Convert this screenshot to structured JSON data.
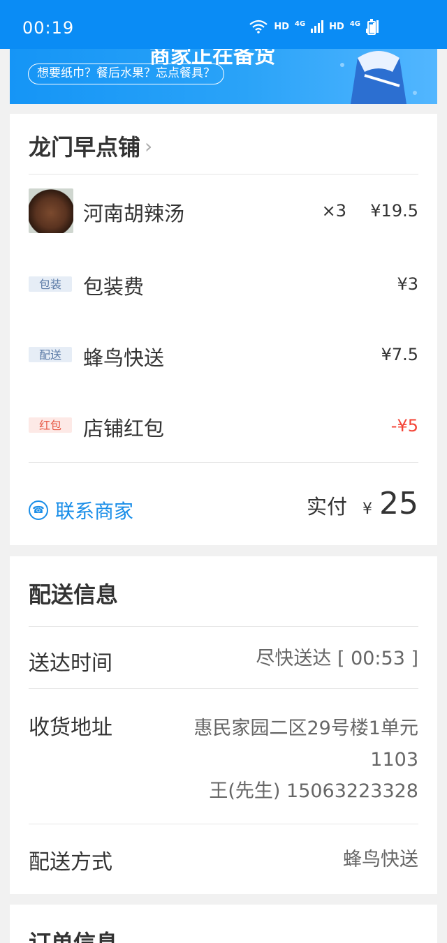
{
  "status_bar": {
    "time": "00:19",
    "network_labels": [
      "HD",
      "4G",
      "HD",
      "4G"
    ]
  },
  "banner": {
    "title": "商家正在备货",
    "promo": "想要纸巾？餐后水果？忘点餐具？"
  },
  "order": {
    "shop_name": "龙门早点铺",
    "items": [
      {
        "name": "河南胡辣汤",
        "qty": "×3",
        "price": "¥19.5"
      }
    ],
    "fees": [
      {
        "tag": "包装",
        "name": "包装费",
        "price": "¥3",
        "tag_color": "blue"
      },
      {
        "tag": "配送",
        "name": "蜂鸟快送",
        "price": "¥7.5",
        "tag_color": "blue"
      },
      {
        "tag": "红包",
        "name": "店铺红包",
        "price": "-¥5",
        "tag_color": "red"
      }
    ],
    "contact_label": "联系商家",
    "paid_label": "实付",
    "currency": "¥",
    "paid_amount": "25"
  },
  "delivery": {
    "title": "配送信息",
    "time_label": "送达时间",
    "time_value": "尽快送达 [ 00:53 ]",
    "address_label": "收货地址",
    "address_line1": "惠民家园二区29号楼1单元",
    "address_line2": "1103",
    "contact_line": "王(先生)  15063223328",
    "method_label": "配送方式",
    "method_value": "蜂鸟快送"
  },
  "order_info": {
    "title": "订单信息"
  },
  "colors": {
    "brand_blue": "#0a8cf5",
    "link_blue": "#1a8ee8",
    "discount_red": "#f44336"
  }
}
